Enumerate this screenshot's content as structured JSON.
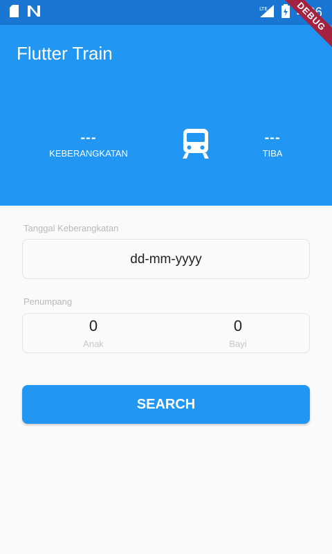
{
  "status_bar": {
    "time": "4:06",
    "network_type": "LTE",
    "icons": [
      "sd-card-icon",
      "n-notification-icon",
      "lte-signal-icon",
      "battery-icon"
    ]
  },
  "debug_banner": "DEBUG",
  "app_bar": {
    "title": "Flutter Train"
  },
  "route": {
    "departure": {
      "code": "---",
      "label": "KEBERANGKATAN"
    },
    "arrival": {
      "code": "---",
      "label": "TIBA"
    },
    "icon": "train-icon"
  },
  "form": {
    "date_label": "Tanggal Keberangkatan",
    "date_placeholder": "dd-mm-yyyy",
    "passenger_label": "Penumpang",
    "adult": {
      "count": "0",
      "label": "Anak"
    },
    "infant": {
      "count": "0",
      "label": "Bayi"
    }
  },
  "search_button": "SEARCH",
  "colors": {
    "primary": "#2196f3",
    "status_bar": "#1976d2",
    "debug_ribbon": "#a4213f"
  }
}
